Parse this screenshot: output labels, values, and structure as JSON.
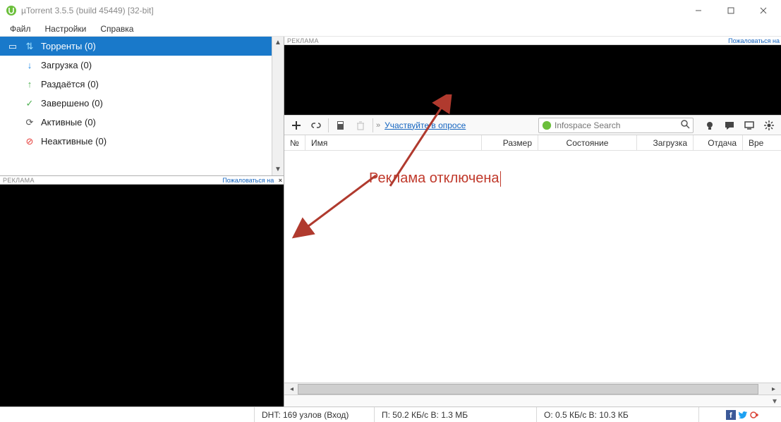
{
  "window": {
    "title": "µTorrent 3.5.5  (build 45449) [32-bit]"
  },
  "menu": {
    "file": "Файл",
    "settings": "Настройки",
    "help": "Справка"
  },
  "sidebar": {
    "torrents": "Торренты (0)",
    "downloading": "Загрузка (0)",
    "seeding": "Раздаётся (0)",
    "completed": "Завершено (0)",
    "active": "Активные (0)",
    "inactive": "Неактивные (0)"
  },
  "ad": {
    "label": "РЕКЛАМА",
    "complain": "Пожаловаться на"
  },
  "toolbar": {
    "survey": "Участвуйте в опросе",
    "search_placeholder": "Infospace Search"
  },
  "columns": {
    "num": "№",
    "name": "Имя",
    "size": "Размер",
    "state": "Состояние",
    "download": "Загрузка",
    "upload": "Отдача",
    "time": "Вре"
  },
  "annotation": "Реклама отключена",
  "status": {
    "dht": "DHT: 169 узлов  (Вход)",
    "down": "П: 50.2 КБ/с В: 1.3 МБ",
    "up": "О: 0.5 КБ/с В: 10.3 КБ"
  }
}
